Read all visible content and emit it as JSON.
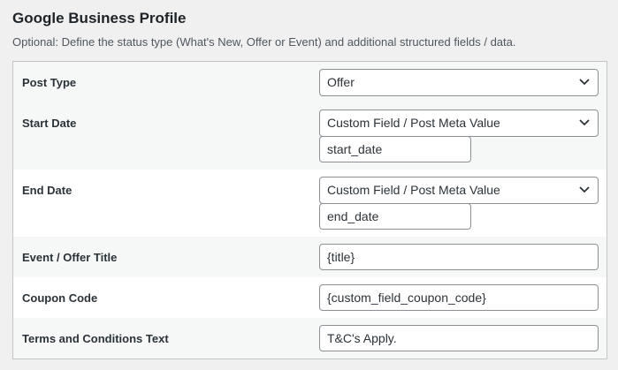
{
  "section": {
    "title": "Google Business Profile",
    "description": "Optional: Define the status type (What's New, Offer or Event) and additional structured fields / data."
  },
  "fields": {
    "post_type": {
      "label": "Post Type",
      "value": "Offer"
    },
    "start_date": {
      "label": "Start Date",
      "source": "Custom Field / Post Meta Value",
      "meta_key": "start_date"
    },
    "end_date": {
      "label": "End Date",
      "source": "Custom Field / Post Meta Value",
      "meta_key": "end_date"
    },
    "event_title": {
      "label": "Event / Offer Title",
      "value": "{title}"
    },
    "coupon_code": {
      "label": "Coupon Code",
      "value": "{custom_field_coupon_code}"
    },
    "terms": {
      "label": "Terms and Conditions Text",
      "value": "T&C's Apply."
    }
  },
  "icons": {
    "select_arrow": "chevron-down-icon"
  }
}
